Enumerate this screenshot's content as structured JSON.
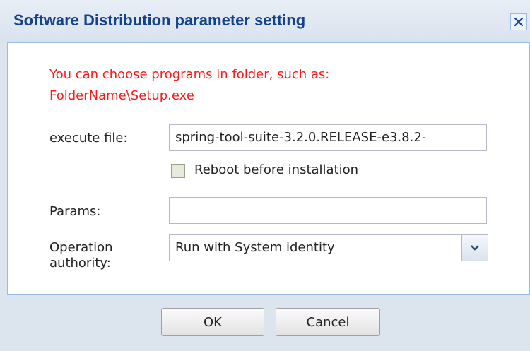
{
  "dialog": {
    "title": "Software Distribution parameter setting",
    "close_icon": "close-icon"
  },
  "form": {
    "hint_line1": "You can choose programs in folder, such as:",
    "hint_line2": "FolderName\\Setup.exe",
    "execute_file_label": "execute file:",
    "execute_file_value": "spring-tool-suite-3.2.0.RELEASE-e3.8.2-",
    "reboot_label": "Reboot before installation",
    "reboot_checked": false,
    "params_label": "Params:",
    "params_value": "",
    "operation_label_line1": "Operation",
    "operation_label_line2": "authority:",
    "operation_value": "Run with System identity",
    "dropdown_icon": "chevron-down-icon"
  },
  "buttons": {
    "ok": "OK",
    "cancel": "Cancel"
  },
  "colors": {
    "title": "#15428b",
    "hint": "#ff1a1a",
    "border": "#99bbe8"
  }
}
